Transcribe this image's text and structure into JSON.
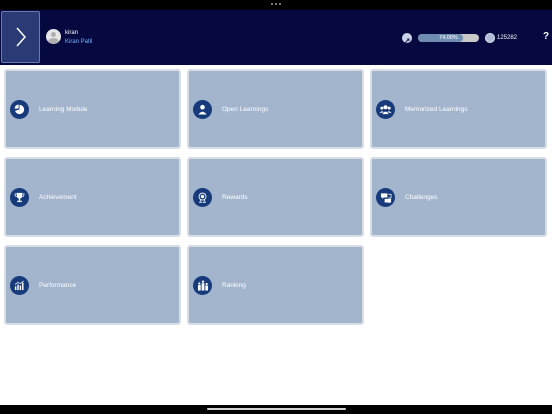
{
  "header": {
    "user_handle": "kiran",
    "user_name": "Kiran Patil",
    "progress_text": "74.00%",
    "progress_percent": 74,
    "coins": "125282",
    "help_label": "?"
  },
  "tiles": [
    {
      "label": "Learning Module",
      "icon": "pie-chart-icon"
    },
    {
      "label": "Open Learnings",
      "icon": "user-icon"
    },
    {
      "label": "Memorized Learnings",
      "icon": "users-icon"
    },
    {
      "label": "Achievement",
      "icon": "trophy-icon"
    },
    {
      "label": "Rewards",
      "icon": "medal-icon"
    },
    {
      "label": "Challenges",
      "icon": "challenge-icon"
    },
    {
      "label": "Performance",
      "icon": "bar-chart-icon"
    },
    {
      "label": "Ranking",
      "icon": "ranking-icon"
    }
  ],
  "colors": {
    "header_bg": "#050940",
    "tile_bg": "#a3b5cd",
    "icon_bg": "#163a7a",
    "link_blue": "#6fb4ff"
  }
}
